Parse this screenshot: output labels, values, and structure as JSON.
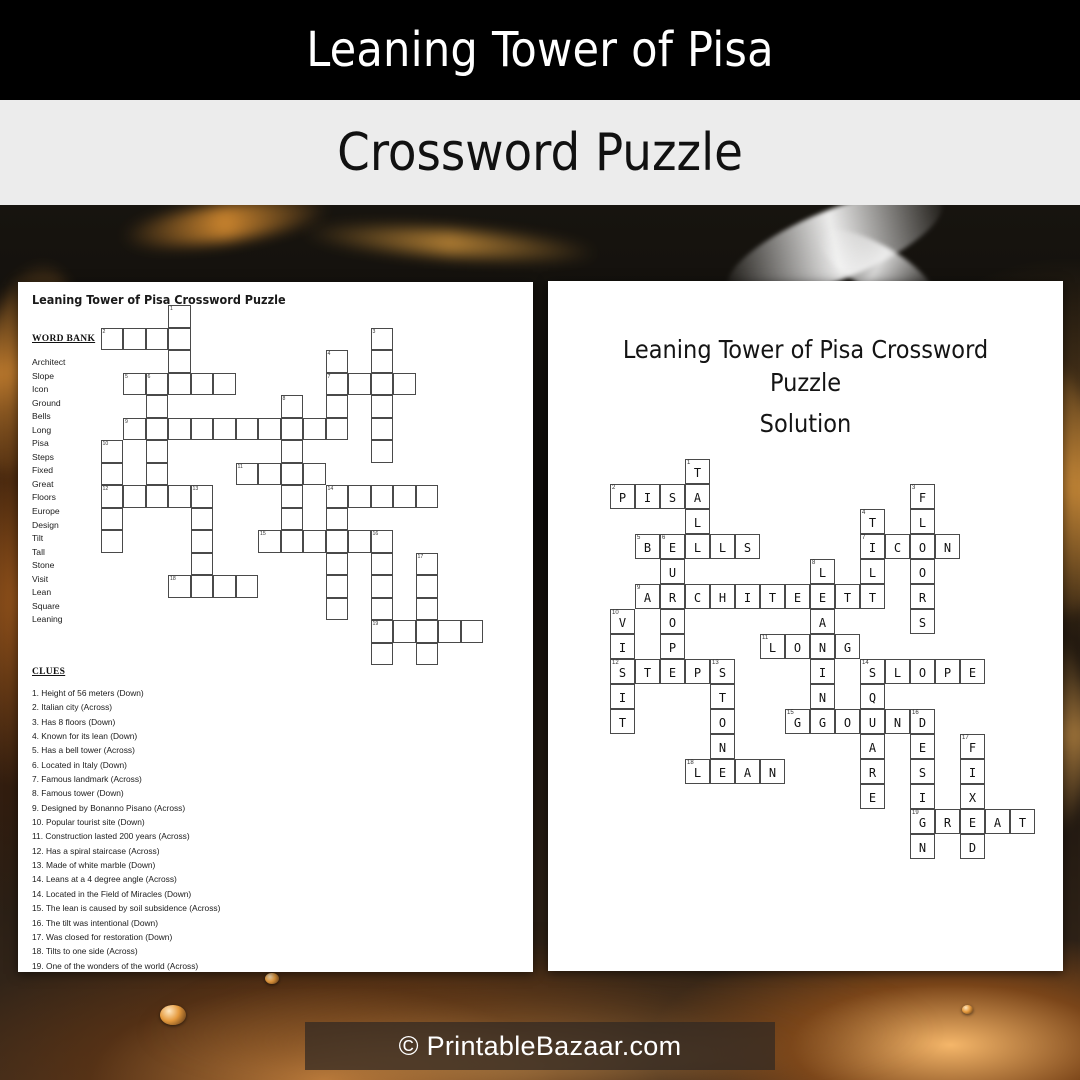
{
  "banner": {
    "title": "Leaning Tower of Pisa",
    "subtitle": "Crossword Puzzle"
  },
  "footer": {
    "credit": "© PrintableBazaar.com"
  },
  "puzzle_page": {
    "title": "Leaning Tower of Pisa Crossword Puzzle",
    "word_bank_heading": "WORD BANK",
    "word_bank": [
      "Architect",
      "Slope",
      "Icon",
      "Ground",
      "Bells",
      "Long",
      "Pisa",
      "Steps",
      "Fixed",
      "Great",
      "Floors",
      "Europe",
      "Design",
      "Tilt",
      "Tall",
      "Stone",
      "Visit",
      "Lean",
      "Square",
      "Leaning"
    ],
    "clues_heading": "CLUES",
    "clues": [
      "1. Height of 56 meters (Down)",
      "2. Italian city (Across)",
      "3. Has 8 floors (Down)",
      "4. Known for its lean (Down)",
      "5. Has a bell tower (Across)",
      "6. Located in Italy (Down)",
      "7. Famous landmark (Across)",
      "8. Famous tower (Down)",
      "9. Designed by Bonanno Pisano (Across)",
      "10. Popular tourist site (Down)",
      "11. Construction lasted 200 years (Across)",
      "12. Has a spiral staircase (Across)",
      "13. Made of white marble (Down)",
      "14. Leans at a 4 degree angle (Across)",
      "14. Located in the Field of Miracles (Down)",
      "15. The lean is caused by soil subsidence (Across)",
      "16. The tilt was intentional (Down)",
      "17. Was closed for restoration (Down)",
      "18. Tilts to one side (Across)",
      "19. One of the wonders of the world (Across)"
    ]
  },
  "solution_page": {
    "title": "Leaning Tower of Pisa Crossword Puzzle",
    "subtitle": "Solution"
  },
  "crossword": {
    "columns": 17,
    "rows": 15,
    "entries": [
      {
        "number": 1,
        "direction": "down",
        "answer": "TALL",
        "row": 0,
        "col": 4,
        "clue": "Height of 56 meters"
      },
      {
        "number": 2,
        "direction": "across",
        "answer": "PISA",
        "row": 1,
        "col": 1,
        "clue": "Italian city"
      },
      {
        "number": 3,
        "direction": "down",
        "answer": "FLOORS",
        "row": 1,
        "col": 13,
        "clue": "Has 8 floors"
      },
      {
        "number": 4,
        "direction": "down",
        "answer": "TILT",
        "row": 2,
        "col": 11,
        "clue": "Known for its lean"
      },
      {
        "number": 5,
        "direction": "across",
        "answer": "BELLS",
        "row": 3,
        "col": 2,
        "clue": "Has a bell tower"
      },
      {
        "number": 6,
        "direction": "down",
        "answer": "EUROPE",
        "row": 3,
        "col": 3,
        "clue": "Located in Italy"
      },
      {
        "number": 7,
        "direction": "across",
        "answer": "ICON",
        "row": 3,
        "col": 11,
        "clue": "Famous landmark"
      },
      {
        "number": 8,
        "direction": "down",
        "answer": "LEANING",
        "row": 4,
        "col": 9,
        "clue": "Famous tower"
      },
      {
        "number": 9,
        "direction": "across",
        "answer": "ARCHITECT",
        "row": 5,
        "col": 2,
        "clue": "Designed by Bonanno Pisano"
      },
      {
        "number": 10,
        "direction": "down",
        "answer": "VISIT",
        "row": 6,
        "col": 1,
        "clue": "Popular tourist site"
      },
      {
        "number": 11,
        "direction": "across",
        "answer": "LONG",
        "row": 7,
        "col": 7,
        "clue": "Construction lasted 200 years"
      },
      {
        "number": 12,
        "direction": "across",
        "answer": "STEPS",
        "row": 8,
        "col": 1,
        "clue": "Has a spiral staircase"
      },
      {
        "number": 13,
        "direction": "down",
        "answer": "STONE",
        "row": 8,
        "col": 5,
        "clue": "Made of white marble"
      },
      {
        "number": 14,
        "direction": "across",
        "answer": "SLOPE",
        "row": 8,
        "col": 11,
        "clue": "Leans at a 4 degree angle"
      },
      {
        "number": 14,
        "direction": "down",
        "answer": "SQUARE",
        "row": 8,
        "col": 11,
        "clue": "Located in the Field of Miracles"
      },
      {
        "number": 15,
        "direction": "across",
        "answer": "GROUND",
        "row": 10,
        "col": 8,
        "clue": "The lean is caused by soil subsidence"
      },
      {
        "number": 16,
        "direction": "down",
        "answer": "DESIGN",
        "row": 10,
        "col": 13,
        "clue": "The tilt was intentional"
      },
      {
        "number": 17,
        "direction": "down",
        "answer": "FIXED",
        "row": 11,
        "col": 15,
        "clue": "Was closed for restoration"
      },
      {
        "number": 18,
        "direction": "across",
        "answer": "LEAN",
        "row": 12,
        "col": 4,
        "clue": "Tilts to one side"
      },
      {
        "number": 19,
        "direction": "across",
        "answer": "GREAT",
        "row": 14,
        "col": 13,
        "clue": "One of the wonders of the world"
      }
    ]
  },
  "colors": {
    "banner_bg": "#000000",
    "subtitle_bg": "#ececec",
    "page_bg": "#ffffff",
    "cell_border": "#4a4a4a",
    "ember_orange": "#ffa84a"
  }
}
